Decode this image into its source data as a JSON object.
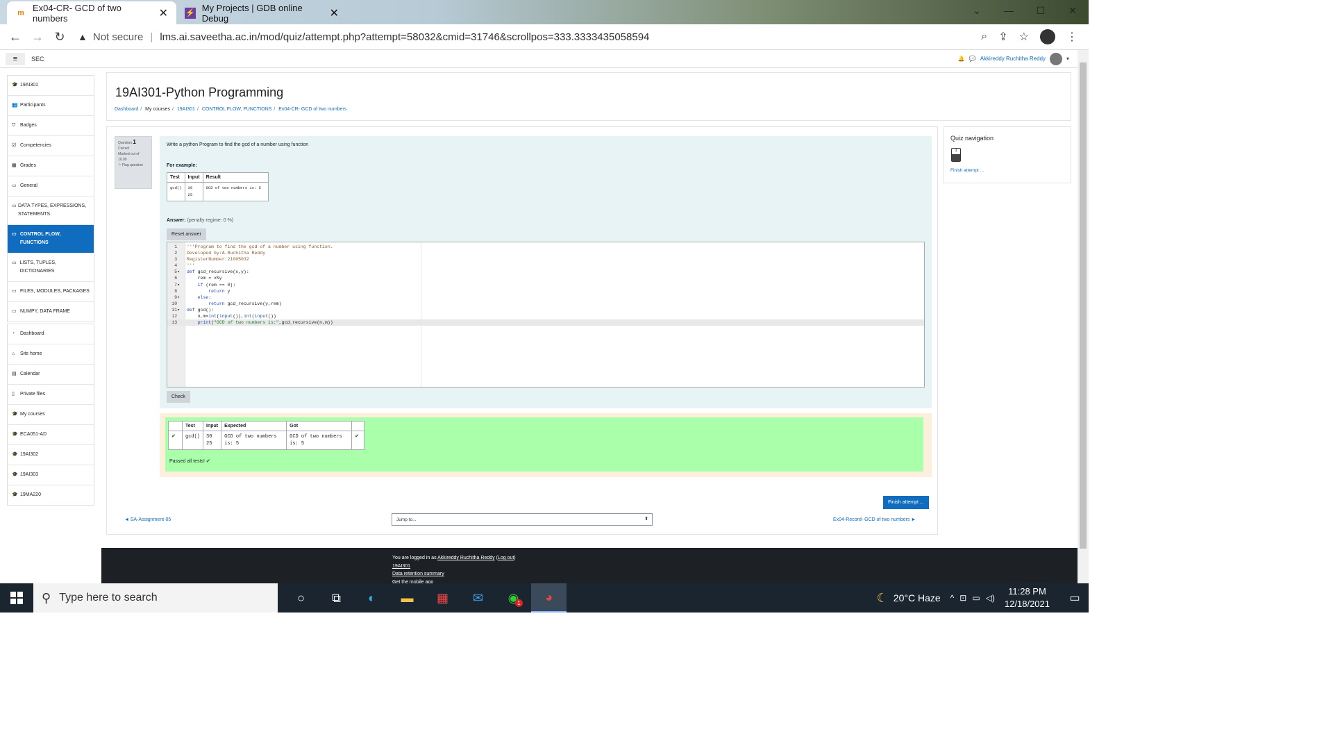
{
  "browser": {
    "tabs": [
      {
        "title": "Ex04-CR- GCD of two numbers",
        "icon": "moodle-favicon",
        "active": true
      },
      {
        "title": "My Projects | GDB online Debug",
        "icon": "gdb-favicon",
        "active": false
      }
    ],
    "security_label": "Not secure",
    "url": "lms.ai.saveetha.ac.in/mod/quiz/attempt.php?attempt=58032&cmid=31746&scrollpos=333.3333435058594"
  },
  "navbar": {
    "site_name": "SEC",
    "user_name": "Akkireddy Ruchitha Reddy"
  },
  "sidebar": {
    "course_group": [
      {
        "label": "19AI301",
        "icon": "graduation-cap-icon"
      },
      {
        "label": "Participants",
        "icon": "users-icon"
      },
      {
        "label": "Badges",
        "icon": "shield-icon"
      },
      {
        "label": "Competencies",
        "icon": "check-square-icon"
      },
      {
        "label": "Grades",
        "icon": "table-icon"
      },
      {
        "label": "General",
        "icon": "folder-icon"
      },
      {
        "label": "DATA TYPES, EXPRESSIONS, STATEMENTS",
        "icon": "folder-icon"
      },
      {
        "label": "CONTROL FLOW, FUNCTIONS",
        "icon": "folder-icon",
        "active": true
      },
      {
        "label": "LISTS, TUPLES, DICTIONARIES",
        "icon": "folder-icon"
      },
      {
        "label": "FILES, MODULES, PACKAGES",
        "icon": "folder-icon"
      },
      {
        "label": "NUMPY, DATA FRAME",
        "icon": "folder-icon"
      }
    ],
    "site_group": [
      {
        "label": "Dashboard",
        "icon": "dashboard-icon"
      },
      {
        "label": "Site home",
        "icon": "home-icon"
      },
      {
        "label": "Calendar",
        "icon": "calendar-icon"
      },
      {
        "label": "Private files",
        "icon": "file-icon"
      },
      {
        "label": "My courses",
        "icon": "graduation-cap-icon"
      },
      {
        "label": "ECA051-AD",
        "icon": "graduation-cap-icon"
      },
      {
        "label": "19AI302",
        "icon": "graduation-cap-icon"
      },
      {
        "label": "19AI303",
        "icon": "graduation-cap-icon"
      },
      {
        "label": "19MA220",
        "icon": "graduation-cap-icon"
      }
    ]
  },
  "header": {
    "title": "19AI301-Python Programming",
    "breadcrumb": [
      "Dashboard",
      "My courses",
      "19AI301",
      "CONTROL FLOW, FUNCTIONS",
      "Ex04-CR- GCD of two numbers"
    ]
  },
  "question": {
    "label": "Question",
    "number": "1",
    "status": "Correct",
    "marked": "Marked out of 10.00",
    "flag": "Flag question",
    "text": "Write a python Program to find the gcd of a number using function",
    "for_example": "For example:",
    "example_headers": [
      "Test",
      "Input",
      "Result"
    ],
    "example_row": {
      "test": "gcd()",
      "input": [
        "30",
        "25"
      ],
      "result": "GCD of two numbers is: 5"
    },
    "answer_label": "Answer:",
    "penalty": "(penalty regime: 0 %)",
    "reset_label": "Reset answer",
    "check_label": "Check",
    "code_lines": [
      "'''Program to find the gcd of a number using function.",
      "Developed by:A.Ruchitha Reddy",
      "RegisterNumber:21005032",
      "'''",
      "def gcd_recursive(x,y):",
      "    rem = x%y",
      "    if (rem == 0):",
      "        return y",
      "    else:",
      "        return gcd_recursive(y,rem)",
      "def gcd():",
      "    n,m=int(input()),int(input())",
      "    print(\"GCD of two numbers is:\",gcd_recursive(n,m))"
    ],
    "fold_lines": [
      5,
      7,
      9,
      11
    ]
  },
  "results": {
    "headers": [
      "",
      "Test",
      "Input",
      "Expected",
      "Got",
      ""
    ],
    "row": {
      "test": "gcd()",
      "input": [
        "30",
        "25"
      ],
      "expected": "GCD of two numbers is: 5",
      "got": "GCD of two numbers is: 5"
    },
    "passed": "Passed all tests!"
  },
  "nav": {
    "finish_label": "Finish attempt ...",
    "prev_label": "◄ SA-Assignment-05",
    "jump_label": "Jump to...",
    "next_label": "Ex04-Record- GCD of two numbers ►"
  },
  "quiz_nav": {
    "title": "Quiz navigation",
    "question_number": "1",
    "finish_link": "Finish attempt ..."
  },
  "footer": {
    "logged_in_prefix": "You are logged in as",
    "user": "Akkireddy Ruchitha Reddy",
    "logout": "Log out",
    "course": "19AI301",
    "data_retention": "Data retention summary",
    "mobile_app": "Get the mobile app"
  },
  "taskbar": {
    "search_placeholder": "Type here to search",
    "weather": "20°C  Haze",
    "time": "11:28 PM",
    "date": "12/18/2021",
    "whatsapp_badge": "1"
  },
  "colors": {
    "primary": "#0f6cbf",
    "question_bg": "#e7f3f5",
    "pass_bg": "#aaffaa",
    "result_frame": "#fcefdc"
  }
}
